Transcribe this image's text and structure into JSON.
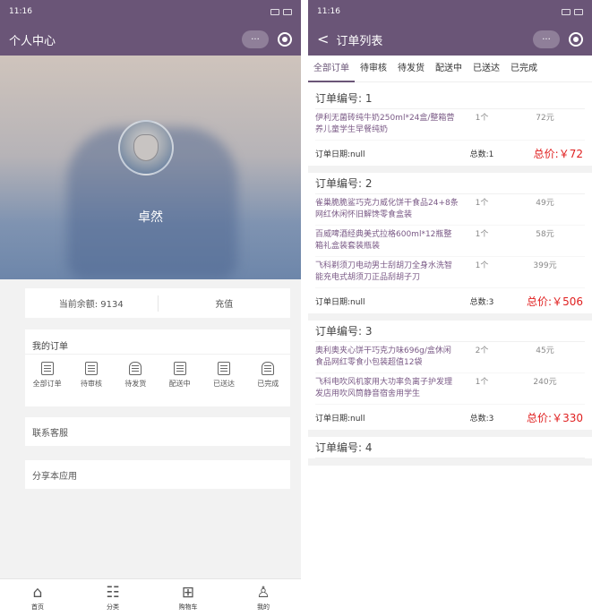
{
  "left": {
    "status": {
      "time": "11:16",
      "dots": "◦ ◦"
    },
    "title": "个人中心",
    "capsule_more": "···",
    "username": "卓然",
    "balance_label": "当前余额: 9134",
    "recharge_label": "充值",
    "my_orders": "我的订单",
    "order_entries": [
      {
        "label": "全部订单",
        "icon": "list-icon"
      },
      {
        "label": "待审核",
        "icon": "document-icon"
      },
      {
        "label": "待发货",
        "icon": "bag-icon"
      },
      {
        "label": "配送中",
        "icon": "list-icon"
      },
      {
        "label": "已送达",
        "icon": "document-icon"
      },
      {
        "label": "已完成",
        "icon": "bag-icon"
      }
    ],
    "contact": "联系客服",
    "share": "分享本应用",
    "tabbar": [
      {
        "label": "首页",
        "icon": "home-icon"
      },
      {
        "label": "分类",
        "icon": "category-icon"
      },
      {
        "label": "购物车",
        "icon": "cart-icon"
      },
      {
        "label": "我的",
        "icon": "user-icon"
      }
    ]
  },
  "right": {
    "status": {
      "time": "11:16",
      "dots": "◦ ◦"
    },
    "back": "<",
    "title": "订单列表",
    "capsule_more": "···",
    "tabs": [
      "全部订单",
      "待审核",
      "待发货",
      "配送中",
      "已送达",
      "已完成"
    ],
    "orders": [
      {
        "head": "订单编号: 1",
        "items": [
          {
            "name": "伊利无菌砖纯牛奶250ml*24盒/整箱营养儿童学生早餐纯奶",
            "qty": "1个",
            "price": "72元"
          }
        ],
        "date": "订单日期:null",
        "count": "总数:1",
        "total": "总价:￥72"
      },
      {
        "head": "订单编号: 2",
        "items": [
          {
            "name": "雀巢脆脆鲨巧克力威化饼干食品24+8条网红休闲怀旧解馋零食盒装",
            "qty": "1个",
            "price": "49元"
          },
          {
            "name": "百威啤酒经典美式拉格600ml*12瓶整箱礼盒装套装瓶装",
            "qty": "1个",
            "price": "58元"
          },
          {
            "name": "飞科剃须刀电动男士刮胡刀全身水洗智能充电式胡须刀正品刮胡子刀",
            "qty": "1个",
            "price": "399元"
          }
        ],
        "date": "订单日期:null",
        "count": "总数:3",
        "total": "总价:￥506"
      },
      {
        "head": "订单编号: 3",
        "items": [
          {
            "name": "奥利奥夹心饼干巧克力味696g/盒休闲食品网红零食小包装超值12袋",
            "qty": "2个",
            "price": "45元"
          },
          {
            "name": "飞科电吹风机家用大功率负离子护发理发店用吹风筒静音宿舍用学生",
            "qty": "1个",
            "price": "240元"
          }
        ],
        "date": "订单日期:null",
        "count": "总数:3",
        "total": "总价:￥330"
      },
      {
        "head": "订单编号: 4",
        "items": [],
        "date": "",
        "count": "",
        "total": ""
      }
    ]
  },
  "colors": {
    "brand": "#6a5577",
    "price_red": "#e02020"
  }
}
